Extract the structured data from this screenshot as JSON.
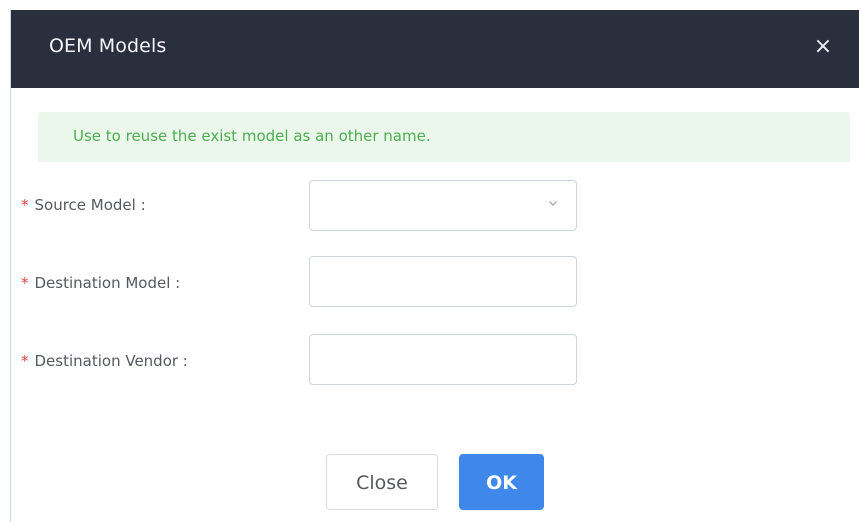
{
  "dialog": {
    "title": "OEM Models",
    "close_icon": "×"
  },
  "notice": {
    "text": "Use to reuse the exist model as an other name."
  },
  "form": {
    "required_marker": "*",
    "source_model": {
      "label": "Source Model :",
      "value": ""
    },
    "destination_model": {
      "label": "Destination Model :",
      "value": "",
      "placeholder": ""
    },
    "destination_vendor": {
      "label": "Destination Vendor :",
      "value": "",
      "placeholder": ""
    }
  },
  "buttons": {
    "close_label": "Close",
    "ok_label": "OK"
  },
  "colors": {
    "header_bg": "#2a2f3d",
    "notice_bg": "#eaf7ea",
    "notice_text": "#4caf50",
    "required": "#e0463e",
    "primary": "#3f88ea"
  },
  "icons": {
    "close": "close-icon",
    "dropdown": "chevron-down-icon"
  }
}
